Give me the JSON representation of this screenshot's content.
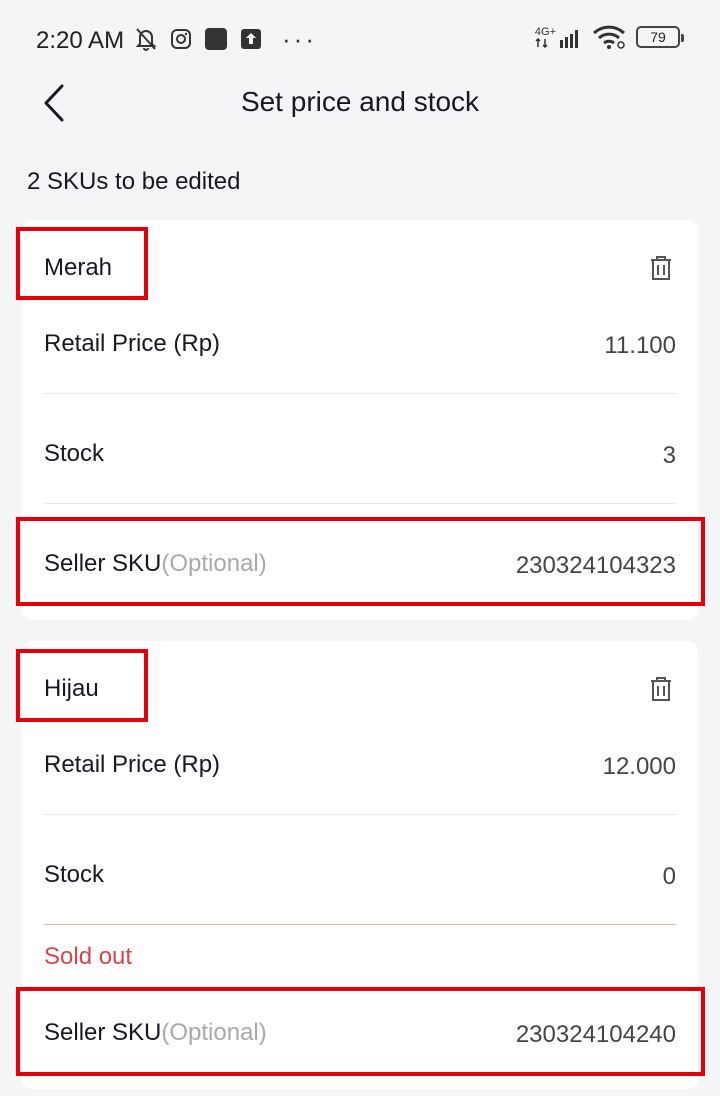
{
  "status_bar": {
    "time": "2:20 AM",
    "network": "4G+",
    "battery": "79",
    "more": "···"
  },
  "nav": {
    "title": "Set price and stock"
  },
  "summary": {
    "count_text": "2 SKUs to be edited"
  },
  "skus": [
    {
      "variant": "Merah",
      "retail_price_label": "Retail Price (Rp)",
      "retail_price": "11.100",
      "stock_label": "Stock",
      "stock": "3",
      "seller_sku_label": "Seller SKU",
      "optional_label": "(Optional)",
      "seller_sku": "230324104323"
    },
    {
      "variant": "Hijau",
      "retail_price_label": "Retail Price (Rp)",
      "retail_price": "12.000",
      "stock_label": "Stock",
      "stock": "0",
      "stock_status": "Sold out",
      "seller_sku_label": "Seller SKU",
      "optional_label": "(Optional)",
      "seller_sku": "230324104240"
    }
  ],
  "colors": {
    "highlight": "#e3000b",
    "sold_out": "#d9444a",
    "optional": "#a7a9ad"
  }
}
